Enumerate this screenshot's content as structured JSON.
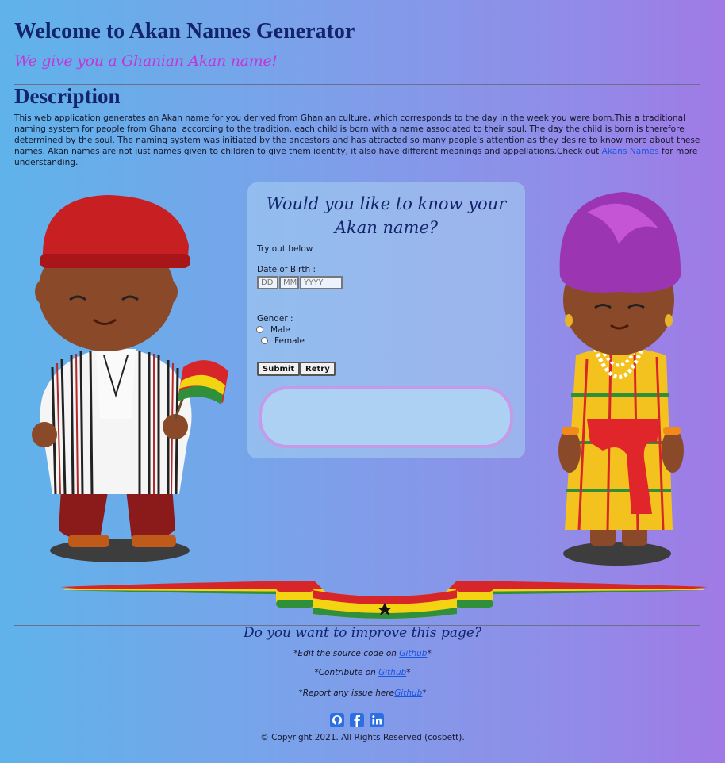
{
  "header": {
    "title": "Welcome to Akan Names Generator",
    "tagline": "We give you a Ghanian Akan name!"
  },
  "description": {
    "heading": "Description",
    "text": "This web application generates an Akan name for you derived from Ghanian culture, which corresponds to the day in the week you were born.This a traditional naming system for people from Ghana, according to the tradition, each child is born with a name associated to their soul. The day the child is born is therefore determined by the soul. The naming system was initiated by the ancestors and has attracted so many people's attention as they desire to know more about these names. Akan names are not just names given to children to give them identity, it also have different meanings and appellations.Check out ",
    "link_text": "Akans Names",
    "text_after": " for more understanding."
  },
  "form": {
    "title": "Would you like to know your Akan name?",
    "intro": "Try out below",
    "dob_label": "Date of Birth :",
    "day_placeholder": "DD",
    "month_placeholder": "MM",
    "year_placeholder": "YYYY",
    "gender_label": "Gender :",
    "male_label": "Male",
    "female_label": "Female",
    "submit_label": "Submit",
    "retry_label": "Retry",
    "result": ""
  },
  "footer": {
    "title": "Do you want to improve this page?",
    "edit_prefix": "*Edit the source code on ",
    "contribute_prefix": "*Contribute on ",
    "issue_prefix": "*Report any issue here",
    "github": "Github",
    "suffix": "*",
    "copyright": "© Copyright 2021. All Rights Reserved (cosbett)."
  },
  "icons": [
    "github-icon",
    "facebook-icon",
    "linkedin-icon"
  ],
  "colors": {
    "heading": "#13246b",
    "accent": "#c236d8",
    "link": "#1a55e0",
    "result_border": "#c59ae8"
  }
}
